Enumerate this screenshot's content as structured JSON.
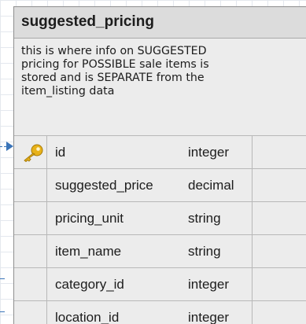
{
  "table": {
    "name": "suggested_pricing",
    "description": "this is where info on SUGGESTED\npricing for POSSIBLE sale items is\nstored and is SEPARATE from the\nitem_listing data",
    "columns": [
      {
        "name": "id",
        "type": "integer",
        "primary_key": true,
        "icon": "key-icon"
      },
      {
        "name": "suggested_price",
        "type": "decimal",
        "primary_key": false
      },
      {
        "name": "pricing_unit",
        "type": "string",
        "primary_key": false
      },
      {
        "name": "item_name",
        "type": "string",
        "primary_key": false
      },
      {
        "name": "category_id",
        "type": "integer",
        "primary_key": false
      },
      {
        "name": "location_id",
        "type": "integer",
        "primary_key": false
      }
    ]
  },
  "colors": {
    "connector": "#3a74b8",
    "header_bg": "#dcdcdc",
    "body_bg": "#ececec",
    "key_gold": "#e8b21a"
  }
}
